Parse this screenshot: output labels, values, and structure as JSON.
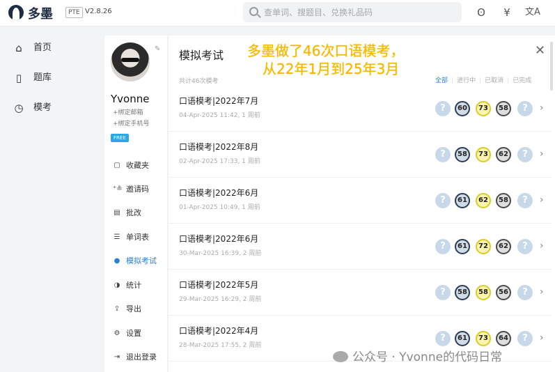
{
  "header": {
    "logo_text": "多墨",
    "product_tag": "PTE",
    "version": "V2.8.26",
    "search_placeholder": "查单词、搜题目、兑换礼品码",
    "icons": [
      "bear-face-icon",
      "yen-icon",
      "translate-icon"
    ],
    "icon_glyphs": {
      "bear": "ʘ",
      "yen": "¥",
      "translate": "文A"
    }
  },
  "sidebar": {
    "items": [
      {
        "label": "首页",
        "icon": "home-icon",
        "glyph": "⌂"
      },
      {
        "label": "题库",
        "icon": "question-bank-icon",
        "glyph": "▯"
      },
      {
        "label": "模考",
        "icon": "timer-icon",
        "glyph": "◷"
      }
    ]
  },
  "profile": {
    "username": "Yvonne",
    "bind_email": "+绑定邮箱",
    "bind_phone": "+绑定手机号",
    "plan_badge": "FREE",
    "menu": [
      {
        "label": "收藏夹",
        "icon": "bookmark-icon",
        "glyph": "▢"
      },
      {
        "label": "邀请码",
        "icon": "invite-icon",
        "glyph": "⁺≗"
      },
      {
        "label": "批改",
        "icon": "grading-icon",
        "glyph": "▤"
      },
      {
        "label": "单词表",
        "icon": "list-icon",
        "glyph": "☰"
      },
      {
        "label": "模拟考试",
        "icon": "mock-exam-icon",
        "glyph": "●",
        "active": true
      },
      {
        "label": "统计",
        "icon": "stats-icon",
        "glyph": "◑"
      },
      {
        "label": "导出",
        "icon": "export-icon",
        "glyph": "⇪"
      },
      {
        "label": "设置",
        "icon": "settings-icon",
        "glyph": "⚙"
      },
      {
        "label": "退出登录",
        "icon": "logout-icon",
        "glyph": "⇥"
      }
    ]
  },
  "main": {
    "title": "模拟考试",
    "close_glyph": "✕",
    "total_text": "共计46次模考",
    "filters": [
      "全部",
      "进行中",
      "已取消",
      "已完成"
    ],
    "active_filter": 0,
    "overlay_line1": "多墨做了46次口语模考，",
    "overlay_line2": "从22年1月到25年3月",
    "rows": [
      {
        "title": "口语模考|2022年7月",
        "meta": "04-Apr-2025 11:42, 1 周前",
        "scores": [
          "60",
          "73",
          "58"
        ]
      },
      {
        "title": "口语模考|2022年8月",
        "meta": "02-Apr-2025 17:33, 1 周前",
        "scores": [
          "58",
          "73",
          "62"
        ]
      },
      {
        "title": "口语模考|2022年6月",
        "meta": "01-Apr-2025 10:49, 1 周前",
        "scores": [
          "61",
          "62",
          "58"
        ]
      },
      {
        "title": "口语模考|2022年6月",
        "meta": "30-Mar-2025 16:39, 2 周前",
        "scores": [
          "61",
          "72",
          "62"
        ]
      },
      {
        "title": "口语模考|2022年5月",
        "meta": "29-Mar-2025 16:29, 2 周前",
        "scores": [
          "58",
          "58",
          "56"
        ]
      },
      {
        "title": "口语模考|2022年4月",
        "meta": "28-Mar-2025 17:55, 2 周前",
        "scores": [
          "61",
          "73",
          "64"
        ]
      }
    ],
    "help_glyph": "?",
    "chevron_glyph": "›"
  },
  "watermark": "公众号 · Yvonne的代码日常",
  "colors": {
    "accent": "#2a7fd4",
    "overlay": "#f5b800",
    "free_badge": "#2ea6e6"
  }
}
